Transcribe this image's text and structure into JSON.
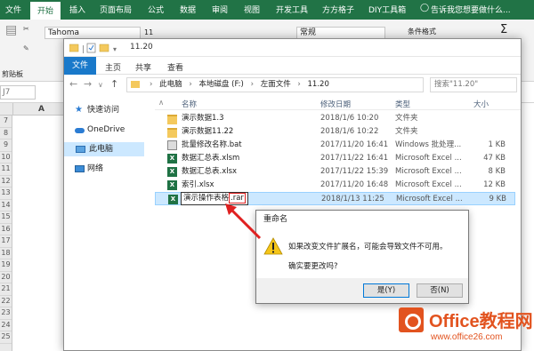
{
  "excel": {
    "tabs": [
      "文件",
      "开始",
      "插入",
      "页面布局",
      "公式",
      "数据",
      "审阅",
      "视图",
      "开发工具",
      "方方格子",
      "DIY工具箱"
    ],
    "active_tab": "开始",
    "tell_me": "告诉我您想要做什么...",
    "font_name": "Tahoma",
    "font_size": "11",
    "number_format": "常规",
    "conditional_format": "条件格式",
    "clipboard_label": "剪贴板",
    "name_box": "J7",
    "column_header": "A",
    "row_numbers": [
      "7",
      "8",
      "9",
      "10",
      "11",
      "12",
      "13",
      "14",
      "15",
      "16",
      "17",
      "18",
      "19",
      "20",
      "21",
      "22",
      "23",
      "24",
      "25"
    ]
  },
  "explorer": {
    "title": "11.20",
    "ribbon_tabs": {
      "file": "文件",
      "home": "主页",
      "share": "共享",
      "view": "查看"
    },
    "breadcrumb": [
      "此电脑",
      "本地磁盘 (F:)",
      "左面文件",
      "11.20"
    ],
    "search_placeholder": "搜索\"11.20\"",
    "nav": [
      {
        "label": "快速访问",
        "icon": "star-icon"
      },
      {
        "label": "OneDrive",
        "icon": "cloud-icon"
      },
      {
        "label": "此电脑",
        "icon": "computer-icon",
        "selected": true
      },
      {
        "label": "网络",
        "icon": "network-icon"
      }
    ],
    "columns": {
      "name": "名称",
      "date": "修改日期",
      "type": "类型",
      "size": "大小"
    },
    "files": [
      {
        "name": "演示数据1.3",
        "date": "2018/1/6 10:20",
        "type": "文件夹",
        "size": "",
        "icon": "folder"
      },
      {
        "name": "演示数据11.22",
        "date": "2018/1/6 10:22",
        "type": "文件夹",
        "size": "",
        "icon": "folder"
      },
      {
        "name": "批量修改名称.bat",
        "date": "2017/11/20 16:41",
        "type": "Windows 批处理...",
        "size": "1 KB",
        "icon": "bat"
      },
      {
        "name": "数据汇总表.xlsm",
        "date": "2017/11/22 16:41",
        "type": "Microsoft Excel ...",
        "size": "47 KB",
        "icon": "xls"
      },
      {
        "name": "数据汇总表.xlsx",
        "date": "2017/11/22 15:39",
        "type": "Microsoft Excel ...",
        "size": "8 KB",
        "icon": "xls"
      },
      {
        "name": "索引.xlsx",
        "date": "2017/11/20 16:48",
        "type": "Microsoft Excel ...",
        "size": "12 KB",
        "icon": "xls"
      }
    ],
    "renaming_file": {
      "name_base": "演示操作表格",
      "name_ext": ".rar",
      "date": "2018/1/13 11:25",
      "type": "Microsoft Excel ...",
      "size": "9 KB"
    }
  },
  "dialog": {
    "title": "重命名",
    "message": "如果改变文件扩展名，可能会导致文件不可用。",
    "question": "确实要更改吗?",
    "yes": "是(Y)",
    "no": "否(N)"
  },
  "watermark": {
    "brand": "Office教程网",
    "url": "www.office26.com"
  },
  "colors": {
    "excel_green": "#217346",
    "selection_blue": "#cce8ff",
    "file_tab_blue": "#1979ca",
    "arrow_red": "#e02020",
    "watermark_orange": "#e2531f"
  }
}
